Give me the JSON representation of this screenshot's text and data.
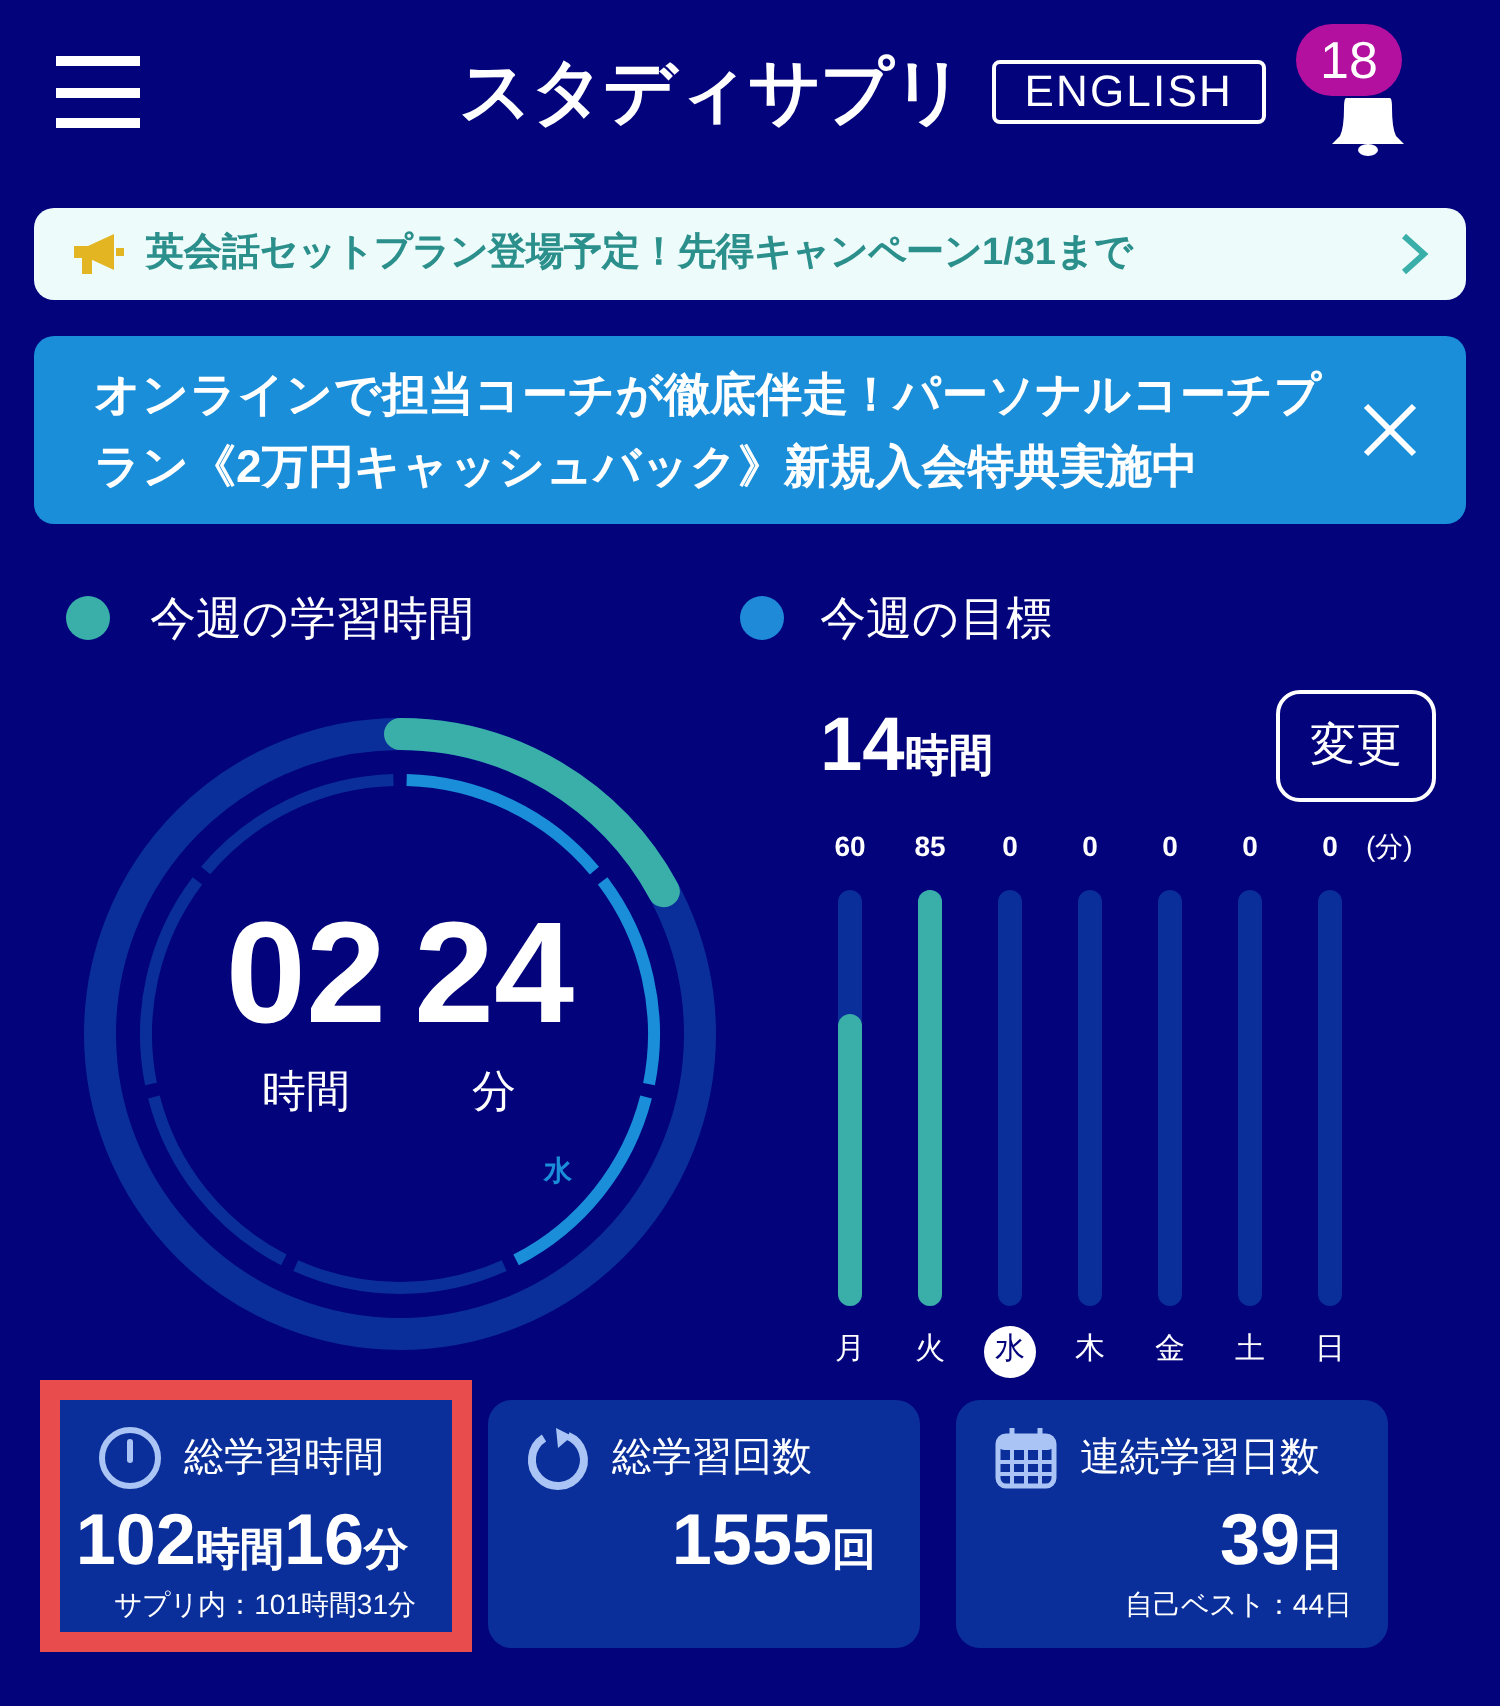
{
  "header": {
    "logo": "スタディサプリ",
    "logo_tag": "ENGLISH",
    "notification_count": "18"
  },
  "notice_banner": {
    "text": "英会話セットプラン登場予定！先得キャンペーン1/31まで"
  },
  "promo_banner": {
    "text": "オンラインで担当コーチが徹底伴走！パーソナルコーチプラン《2万円キャッシュバック》新規入会特典実施中"
  },
  "weekly_time": {
    "legend": "今週の学習時間",
    "color": "#3aafa9",
    "level": 0.171,
    "hours": "02",
    "hours_unit": "時間",
    "minutes": "24",
    "minutes_unit": "分",
    "today_label": "水"
  },
  "weekly_goal": {
    "legend": "今週の目標",
    "color": "#1e8ad8",
    "value_parts": [
      {
        "kind": "number",
        "text": "14"
      },
      {
        "kind": "unit",
        "text": "時間"
      }
    ],
    "change_button": "変更",
    "unit_label": "(分)",
    "week_days": [
      {
        "day": "月",
        "minutes": "60",
        "level": 0.7,
        "selected": false
      },
      {
        "day": "火",
        "minutes": "85",
        "level": 1,
        "selected": false
      },
      {
        "day": "水",
        "minutes": "0",
        "selected": true
      },
      {
        "day": "木",
        "minutes": "0",
        "selected": false
      },
      {
        "day": "金",
        "minutes": "0",
        "selected": false
      },
      {
        "day": "土",
        "minutes": "0",
        "selected": false
      },
      {
        "day": "日",
        "minutes": "0",
        "selected": false
      }
    ]
  },
  "stats": [
    {
      "kind": "time",
      "label": "総学習時間",
      "highlighted": true,
      "value_parts": [
        {
          "kind": "number",
          "text": "102"
        },
        {
          "kind": "unit",
          "text": "時間"
        },
        {
          "kind": "number",
          "text": "16"
        },
        {
          "kind": "unit",
          "text": "分"
        }
      ],
      "note": "サプリ内：101時間31分"
    },
    {
      "kind": "count",
      "label": "総学習回数",
      "highlighted": false,
      "value_parts": [
        {
          "kind": "number",
          "text": "1555"
        },
        {
          "kind": "unit",
          "text": "回"
        }
      ]
    },
    {
      "kind": "streak",
      "label": "連続学習日数",
      "highlighted": false,
      "value_parts": [
        {
          "kind": "number",
          "text": "39"
        },
        {
          "kind": "unit",
          "text": "日"
        }
      ],
      "note": "自己ベスト：44日"
    }
  ]
}
